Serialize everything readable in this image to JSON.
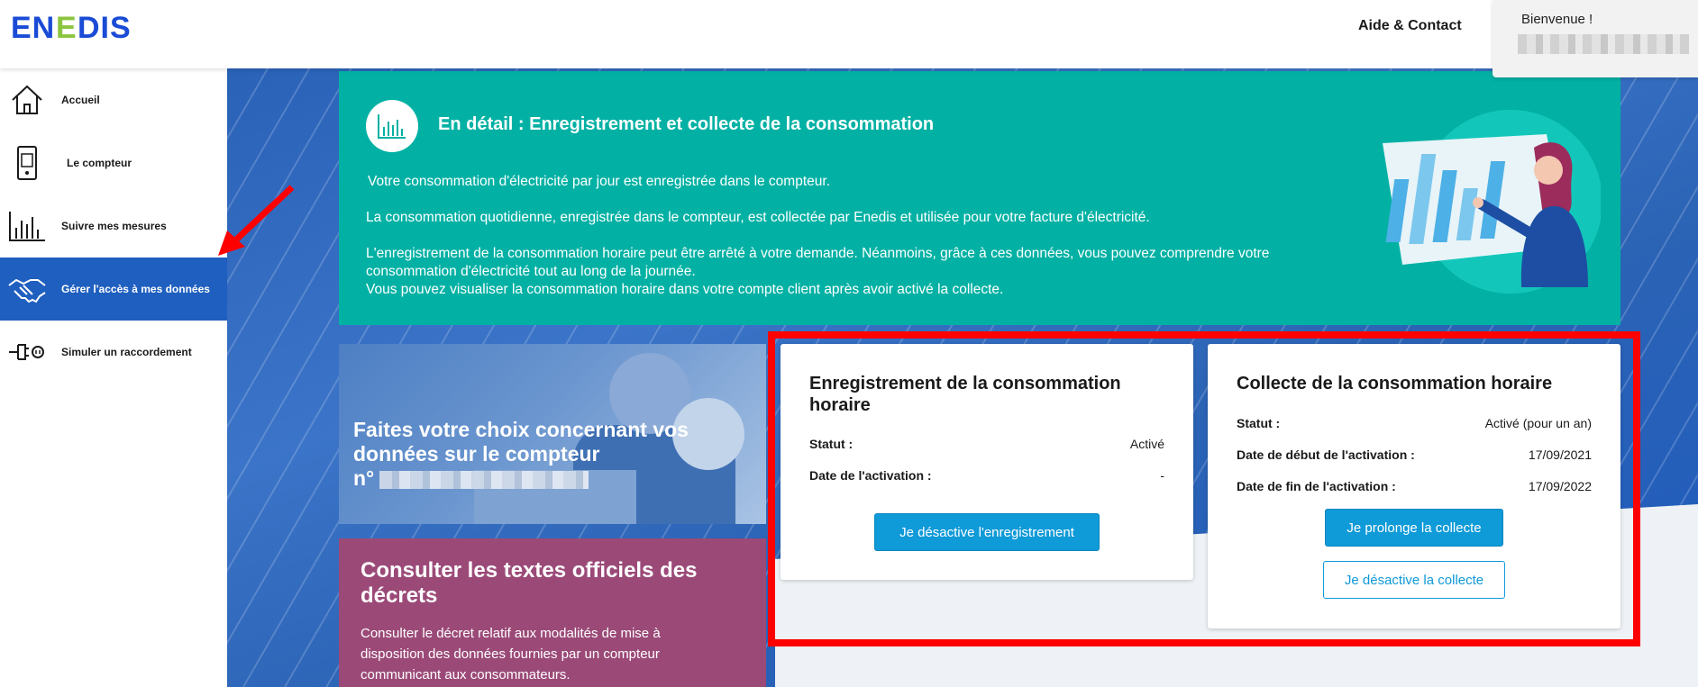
{
  "header": {
    "logo_text": "enedis",
    "help_label": "Aide & Contact",
    "welcome_label": "Bienvenue !"
  },
  "sidebar": {
    "items": [
      {
        "label": "Accueil",
        "icon": "home-icon"
      },
      {
        "label": "Le compteur",
        "icon": "meter-icon"
      },
      {
        "label": "Suivre mes mesures",
        "icon": "bar-chart-icon"
      },
      {
        "label": "Gérer l'accès à mes données",
        "icon": "handshake-icon",
        "active": true
      },
      {
        "label": "Simuler un raccordement",
        "icon": "plug-icon"
      }
    ]
  },
  "banner": {
    "title": "En détail : Enregistrement et collecte de la consommation",
    "paragraph_1": "Votre consommation d'électricité par jour est enregistrée dans le compteur.",
    "paragraph_2": "La consommation quotidienne, enregistrée dans le compteur, est collectée par Enedis et utilisée pour votre facture d'électricité.",
    "paragraph_3_line_1": "L'enregistrement de la consommation horaire peut être arrêté à votre demande. Néanmoins, grâce à ces données, vous pouvez comprendre votre consommation d'électricité tout au long de la journée.",
    "paragraph_3_line_2": "Vous pouvez visualiser la consommation horaire dans votre compte client après avoir activé la collecte."
  },
  "photo_card": {
    "title": "Faites votre choix concernant vos données sur le compteur",
    "number_prefix": "n°"
  },
  "decree_card": {
    "title": "Consulter les textes officiels des décrets",
    "text": "Consulter le décret relatif aux modalités de mise à disposition des données fournies par un compteur communicant aux consommateurs."
  },
  "recording_card": {
    "title": "Enregistrement de la consommation horaire",
    "status_label": "Statut :",
    "status_value": "Activé",
    "activation_date_label": "Date de l'activation :",
    "activation_date_value": "-",
    "deactivate_button": "Je désactive l'enregistrement"
  },
  "collection_card": {
    "title": "Collecte de la consommation horaire",
    "status_label": "Statut :",
    "status_value": "Activé (pour un an)",
    "start_date_label": "Date de début de l'activation :",
    "start_date_value": "17/09/2021",
    "end_date_label": "Date de fin de l'activation :",
    "end_date_value": "17/09/2022",
    "extend_button": "Je prolonge la collecte",
    "deactivate_button": "Je désactive la collecte"
  },
  "colors": {
    "brand_blue": "#1f5fbf",
    "teal": "#02b1a4",
    "plum": "#9b4a78",
    "button_blue": "#0f9ad8",
    "highlight_red": "#ff0000"
  }
}
